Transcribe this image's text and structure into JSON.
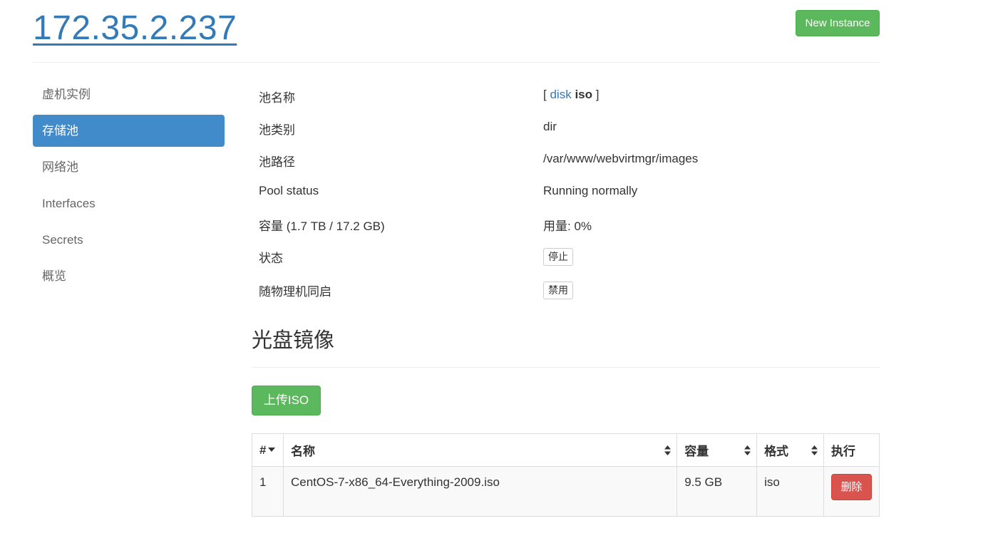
{
  "header": {
    "host": "172.35.2.237",
    "new_instance": "New Instance"
  },
  "sidebar": {
    "items": [
      {
        "label": "虚机实例",
        "active": false
      },
      {
        "label": "存储池",
        "active": true
      },
      {
        "label": "网络池",
        "active": false
      },
      {
        "label": "Interfaces",
        "active": false
      },
      {
        "label": "Secrets",
        "active": false
      },
      {
        "label": "概览",
        "active": false
      }
    ]
  },
  "pool": {
    "name_label": "池名称",
    "name_open": "[",
    "name_link": "disk",
    "name_bold": "iso",
    "name_close": "]",
    "type_label": "池类别",
    "type_value": "dir",
    "path_label": "池路径",
    "path_value": "/var/www/webvirtmgr/images",
    "status_label": "Pool status",
    "status_value": "Running normally",
    "capacity_label": "容量 (1.7 TB / 17.2 GB)",
    "usage_value": "用量: 0%",
    "state_label": "状态",
    "state_button": "停止",
    "autostart_label": "随物理机同启",
    "autostart_button": "禁用"
  },
  "iso_section": {
    "title": "光盘镜像",
    "upload_button": "上传ISO",
    "table": {
      "headers": [
        "#",
        "名称",
        "容量",
        "格式",
        "执行"
      ],
      "rows": [
        {
          "num": "1",
          "name": "CentOS-7-x86_64-Everything-2009.iso",
          "size": "9.5 GB",
          "format": "iso",
          "action": "删除"
        }
      ]
    }
  },
  "colors": {
    "primary": "#428bca",
    "success": "#5cb85c",
    "danger": "#d9534f",
    "link": "#337ab7"
  }
}
